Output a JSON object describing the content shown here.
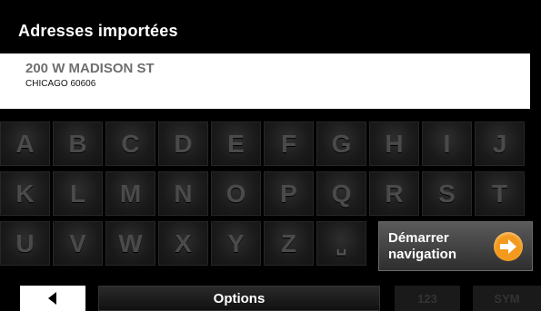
{
  "header": {
    "title": "Adresses importées"
  },
  "address": {
    "line1": "200 W MADISON ST",
    "line2": "CHICAGO 60606"
  },
  "keyboard": {
    "row1": [
      "A",
      "B",
      "C",
      "D",
      "E",
      "F",
      "G",
      "H",
      "I",
      "J"
    ],
    "row2": [
      "K",
      "L",
      "M",
      "N",
      "O",
      "P",
      "Q",
      "R",
      "S",
      "T"
    ],
    "row3": [
      "U",
      "V",
      "W",
      "X",
      "Y",
      "Z",
      "␣"
    ]
  },
  "start_button": {
    "line1": "Démarrer",
    "line2": "navigation",
    "icon": "arrow-right-circle-icon",
    "color": "#f39a1e"
  },
  "bottom_bar": {
    "back_icon": "back-arrow-icon",
    "options_label": "Options",
    "num_label": "123",
    "sym_label": "SYM"
  }
}
